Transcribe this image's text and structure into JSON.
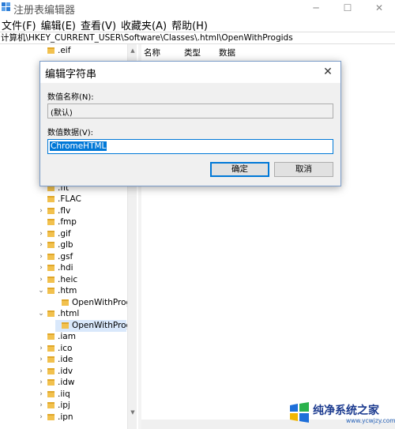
{
  "window": {
    "title": "注册表编辑器",
    "controls": {
      "minimize": "─",
      "maximize": "☐",
      "close": "✕"
    }
  },
  "menu": [
    "文件(F)",
    "编辑(E)",
    "查看(V)",
    "收藏夹(A)",
    "帮助(H)"
  ],
  "address": "计算机\\HKEY_CURRENT_USER\\Software\\Classes\\.html\\OpenWithProgids",
  "list_headers": {
    "name": "名称",
    "type": "类型",
    "data": "数据"
  },
  "tree": [
    {
      "label": ".eif",
      "expander": ""
    },
    {
      "label": ".fit",
      "expander": ""
    },
    {
      "label": ".FLAC",
      "expander": ""
    },
    {
      "label": ".flv",
      "expander": ">"
    },
    {
      "label": ".fmp",
      "expander": ""
    },
    {
      "label": ".gif",
      "expander": ">"
    },
    {
      "label": ".glb",
      "expander": ">"
    },
    {
      "label": ".gsf",
      "expander": ">"
    },
    {
      "label": ".hdi",
      "expander": ">"
    },
    {
      "label": ".heic",
      "expander": ">"
    },
    {
      "label": ".htm",
      "expander": "v"
    },
    {
      "label": "OpenWithProgi",
      "expander": ""
    },
    {
      "label": ".html",
      "expander": "v"
    },
    {
      "label": "OpenWithProgi",
      "expander": ""
    },
    {
      "label": ".iam",
      "expander": ""
    },
    {
      "label": ".ico",
      "expander": ">"
    },
    {
      "label": ".ide",
      "expander": ">"
    },
    {
      "label": ".idv",
      "expander": ">"
    },
    {
      "label": ".idw",
      "expander": ">"
    },
    {
      "label": ".iiq",
      "expander": ">"
    },
    {
      "label": ".ipj",
      "expander": ">"
    },
    {
      "label": ".ipn",
      "expander": ">"
    }
  ],
  "dialog": {
    "title": "编辑字符串",
    "close": "✕",
    "name_label": "数值名称(N):",
    "name_value": "(默认)",
    "data_label": "数值数据(V):",
    "data_value": "ChromeHTML",
    "ok": "确定",
    "cancel": "取消"
  },
  "watermark": {
    "text": "纯净系统之家",
    "sub": "www.ycwjzy.com"
  }
}
